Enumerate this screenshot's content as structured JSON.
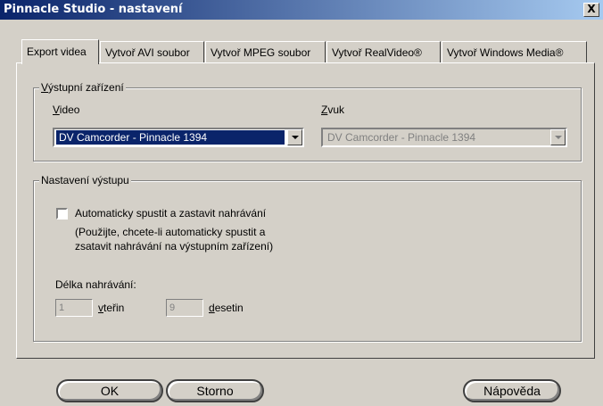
{
  "window": {
    "title": "Pinnacle Studio - nastavení",
    "close_label": "X"
  },
  "tabs": [
    {
      "label": "Export videa",
      "active": true
    },
    {
      "label": "Vytvoř AVI soubor",
      "active": false
    },
    {
      "label": "Vytvoř MPEG soubor",
      "active": false
    },
    {
      "label": "Vytvoř RealVideo®",
      "active": false
    },
    {
      "label": "Vytvoř Windows Media®",
      "active": false
    }
  ],
  "output_device": {
    "legend": "Výstupní zařízení",
    "video_label": "Video",
    "video_value": "DV Camcorder - Pinnacle 1394",
    "audio_label": "Zvuk",
    "audio_value": "DV Camcorder - Pinnacle 1394"
  },
  "output_settings": {
    "legend": "Nastavení výstupu",
    "auto_checkbox_label": "Automaticky spustit a zastavit nahrávání",
    "auto_checkbox_checked": false,
    "hint_line1": "(Použijte, chcete-li automaticky spustit a",
    "hint_line2": "zsatavit nahrávání na výstupním zařízení)",
    "length_label": "Délka nahrávání:",
    "seconds_value": "1",
    "seconds_label": "vteřin",
    "tenths_value": "9",
    "tenths_label": "desetin"
  },
  "buttons": {
    "ok": "OK",
    "cancel": "Storno",
    "help": "Nápověda"
  }
}
